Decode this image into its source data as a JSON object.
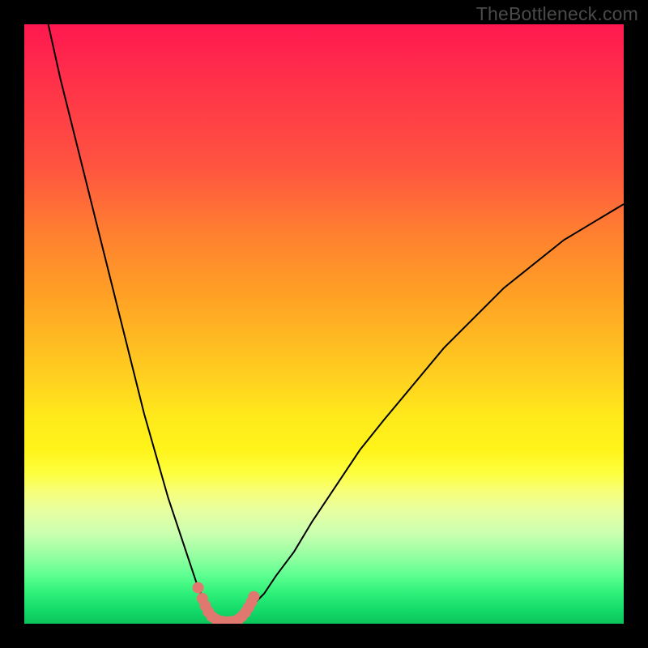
{
  "watermark": "TheBottleneck.com",
  "chart_data": {
    "type": "line",
    "title": "",
    "xlabel": "",
    "ylabel": "",
    "xlim": [
      0,
      100
    ],
    "ylim": [
      0,
      100
    ],
    "grid": false,
    "note": "V-shaped bottleneck curve over vertical rainbow gradient (red→green). Trough near x≈34, y≈0. Pink dotted highlight near trough.",
    "series": [
      {
        "name": "curve-left",
        "x": [
          4,
          6,
          8,
          10,
          12,
          14,
          16,
          18,
          20,
          22,
          24,
          26,
          28,
          29,
          30,
          31,
          32
        ],
        "y": [
          100,
          91,
          83,
          75,
          67,
          59,
          51,
          43,
          35,
          28,
          21,
          15,
          9,
          6,
          4,
          2,
          1
        ]
      },
      {
        "name": "curve-right",
        "x": [
          36,
          37,
          38,
          40,
          42,
          45,
          48,
          52,
          56,
          60,
          65,
          70,
          75,
          80,
          85,
          90,
          95,
          100
        ],
        "y": [
          1,
          2,
          3,
          5,
          8,
          12,
          17,
          23,
          29,
          34,
          40,
          46,
          51,
          56,
          60,
          64,
          67,
          70
        ]
      },
      {
        "name": "trough-flat",
        "x": [
          32,
          33,
          34,
          35,
          36
        ],
        "y": [
          1,
          0.4,
          0.2,
          0.4,
          1
        ]
      }
    ],
    "highlight_points": [
      {
        "x": 29.0,
        "y": 6.0,
        "r": 1.0
      },
      {
        "x": 29.7,
        "y": 4.2
      },
      {
        "x": 30.2,
        "y": 3.0
      },
      {
        "x": 30.7,
        "y": 2.0
      },
      {
        "x": 31.3,
        "y": 1.2
      },
      {
        "x": 32.0,
        "y": 0.7
      },
      {
        "x": 32.8,
        "y": 0.4
      },
      {
        "x": 33.5,
        "y": 0.3
      },
      {
        "x": 34.3,
        "y": 0.3
      },
      {
        "x": 35.0,
        "y": 0.4
      },
      {
        "x": 35.7,
        "y": 0.7
      },
      {
        "x": 36.3,
        "y": 1.2
      },
      {
        "x": 36.9,
        "y": 1.9
      },
      {
        "x": 37.4,
        "y": 2.7
      },
      {
        "x": 37.9,
        "y": 3.6
      },
      {
        "x": 38.3,
        "y": 4.5
      }
    ],
    "gradient_stops": [
      {
        "pos": 0,
        "color": "#ff1850"
      },
      {
        "pos": 24,
        "color": "#ff5540"
      },
      {
        "pos": 60,
        "color": "#ffd41f"
      },
      {
        "pos": 78,
        "color": "#f7ff7a"
      },
      {
        "pos": 92,
        "color": "#5cff90"
      },
      {
        "pos": 100,
        "color": "#0cc45c"
      }
    ],
    "highlight_color": "#e0786f",
    "curve_color": "#000000"
  }
}
